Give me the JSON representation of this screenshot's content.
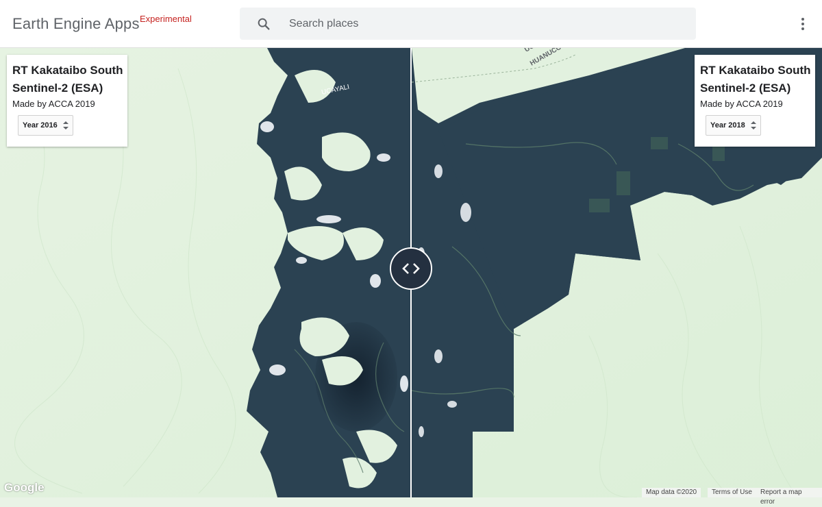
{
  "header": {
    "brand": "Earth Engine Apps",
    "badge": "Experimental",
    "search_placeholder": "Search places",
    "menu_icon": "more-vert-icon",
    "search_icon": "search-icon"
  },
  "left_panel": {
    "title_line1": "RT Kakataibo South",
    "title_line2": "Sentinel-2 (ESA)",
    "subtitle": "Made by ACCA 2019",
    "year_selected": "Year 2016"
  },
  "right_panel": {
    "title_line1": "RT Kakataibo South",
    "title_line2": "Sentinel-2 (ESA)",
    "subtitle": "Made by ACCA 2019",
    "year_selected": "Year 2018"
  },
  "map": {
    "place_label_1": "UCAYALI",
    "place_label_2": "HUANUCO",
    "place_label_3": "UCAYALI",
    "divider_icon": "swap-horizontal-icon",
    "colors": {
      "terrain": "#e2f1df",
      "forest": "#2b4252",
      "forest_dark": "#1f3243",
      "cloud": "#f4f7fb"
    }
  },
  "footer": {
    "logo": "Google",
    "map_data": "Map data ©2020",
    "terms": "Terms of Use",
    "report": "Report a map error"
  }
}
